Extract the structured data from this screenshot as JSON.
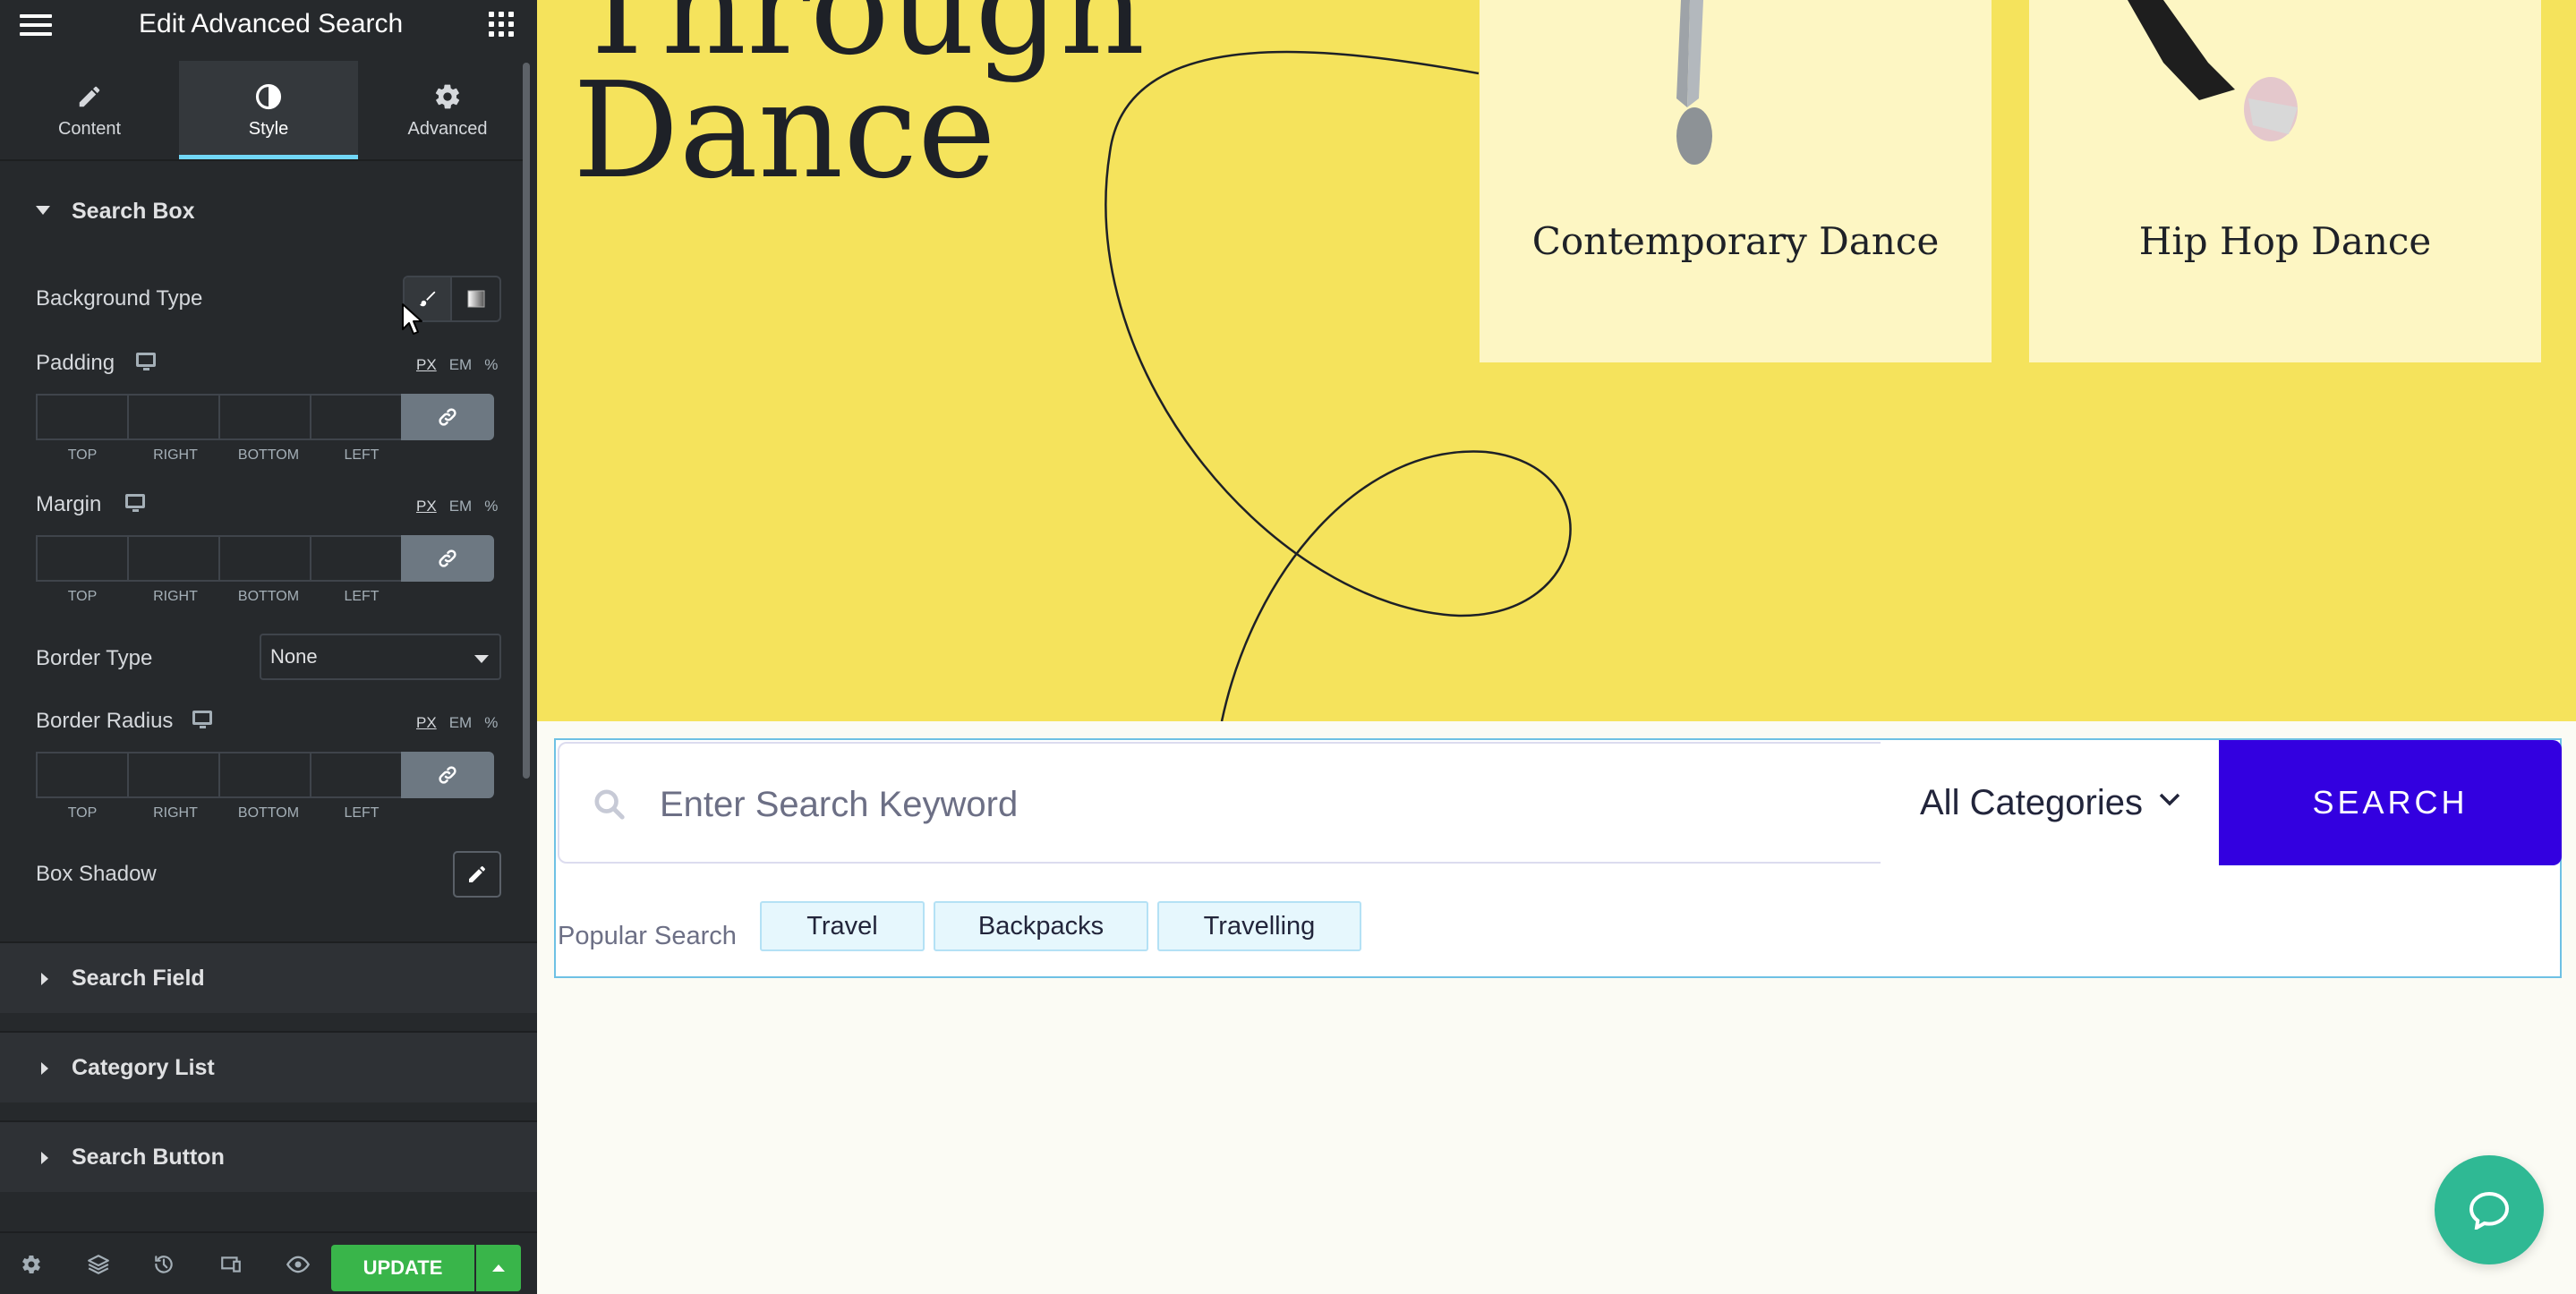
{
  "panel": {
    "title": "Edit Advanced Search",
    "tabs": [
      {
        "label": "Content",
        "icon": "pencil-icon"
      },
      {
        "label": "Style",
        "icon": "half-circle-icon"
      },
      {
        "label": "Advanced",
        "icon": "gear-icon"
      }
    ],
    "active_tab": "Style",
    "search_box_section": {
      "title": "Search Box",
      "background_type_label": "Background Type",
      "padding_label": "Padding",
      "margin_label": "Margin",
      "border_type_label": "Border Type",
      "border_type_value": "None",
      "border_radius_label": "Border Radius",
      "box_shadow_label": "Box Shadow",
      "units": [
        "PX",
        "EM",
        "%"
      ],
      "dimension_labels": [
        "TOP",
        "RIGHT",
        "BOTTOM",
        "LEFT"
      ]
    },
    "collapsed_sections": [
      "Search Field",
      "Category List",
      "Search Button"
    ],
    "footer": {
      "update_label": "UPDATE",
      "icons": [
        "gear-icon",
        "layers-icon",
        "history-icon",
        "responsive-icon",
        "eye-icon"
      ]
    }
  },
  "preview": {
    "hero_lines": [
      "Through",
      "Dance"
    ],
    "cards": [
      {
        "title": "Contemporary Dance"
      },
      {
        "title": "Hip Hop Dance"
      }
    ],
    "search": {
      "placeholder": "Enter Search Keyword",
      "category_value": "All Categories",
      "button_label": "SEARCH"
    },
    "popular": {
      "label": "Popular Search",
      "tags": [
        "Travel",
        "Backpacks",
        "Travelling"
      ]
    }
  },
  "colors": {
    "panel_bg": "#26292c",
    "active_tab_accent": "#71d7f7",
    "hero_bg": "#f5e35c",
    "card_bg": "#fdf6c3",
    "search_button": "#3300e0",
    "update_button": "#39b54a",
    "chat_button": "#2fb994"
  }
}
